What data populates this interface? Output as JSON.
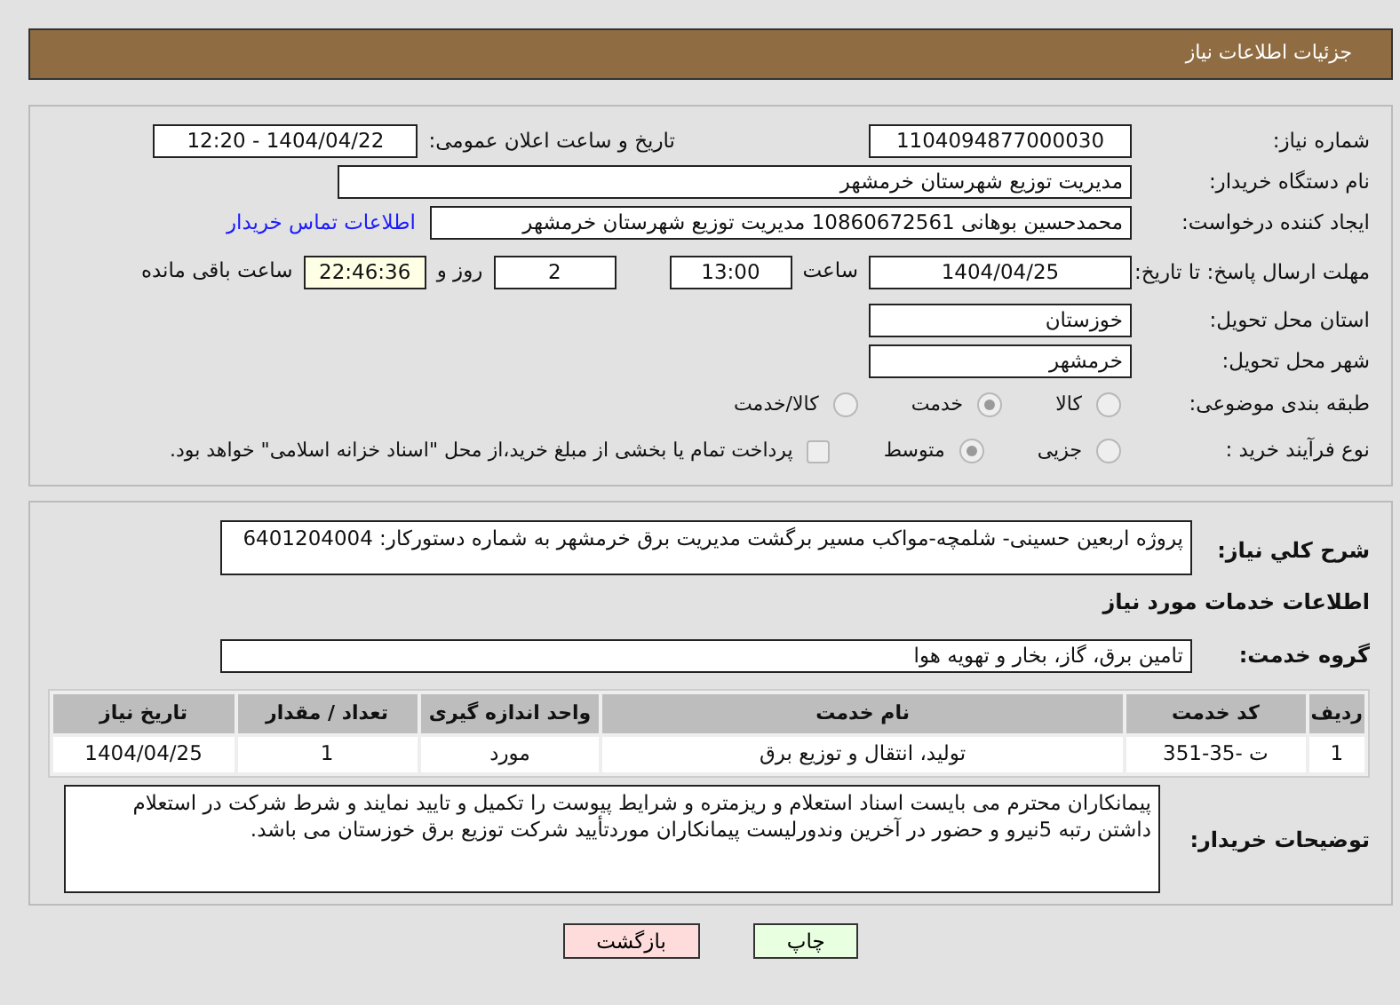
{
  "header": {
    "title": "جزئیات اطلاعات نیاز"
  },
  "need_number": {
    "label": "شماره نیاز:",
    "value": "1104094877000030"
  },
  "announce": {
    "label": "تاریخ و ساعت اعلان عمومی:",
    "value": "1404/04/22 - 12:20"
  },
  "buyer_org": {
    "label": "نام دستگاه خریدار:",
    "value": "مدیریت توزیع شهرستان خرمشهر"
  },
  "requester": {
    "label": "ایجاد کننده درخواست:",
    "value": "محمدحسین بوهانی 10860672561 مدیریت توزیع شهرستان خرمشهر",
    "link": "اطلاعات تماس خریدار"
  },
  "deadline": {
    "label": "مهلت ارسال پاسخ: تا تاریخ:",
    "date": "1404/04/25",
    "time_label": "ساعت",
    "time": "13:00",
    "days": "2",
    "days_label": "روز و",
    "remaining": "22:46:36",
    "remaining_label": "ساعت باقی مانده"
  },
  "province": {
    "label": "استان محل تحویل:",
    "value": "خوزستان"
  },
  "city": {
    "label": "شهر محل تحویل:",
    "value": "خرمشهر"
  },
  "category": {
    "label": "طبقه بندی موضوعی:",
    "options": [
      {
        "label": "کالا",
        "selected": false
      },
      {
        "label": "خدمت",
        "selected": true
      },
      {
        "label": "کالا/خدمت",
        "selected": false
      }
    ]
  },
  "process": {
    "label": "نوع فرآیند خرید :",
    "options": [
      {
        "label": "جزیی",
        "selected": false
      },
      {
        "label": "متوسط",
        "selected": true
      }
    ],
    "payment": {
      "label": "پرداخت تمام یا بخشی از مبلغ خرید،از محل \"اسناد خزانه اسلامی\" خواهد بود.",
      "checked": false
    }
  },
  "description": {
    "label": "شرح کلي نیاز:",
    "value": "پروژه اربعین حسینی- شلمچه-مواکب مسیر برگشت مدیریت برق خرمشهر به شماره دستورکار: 6401204004"
  },
  "services_title": "اطلاعات خدمات مورد نیاز",
  "service_group": {
    "label": "گروه خدمت:",
    "value": "تامین برق، گاز، بخار و تهویه هوا"
  },
  "table": {
    "columns": [
      "ردیف",
      "کد خدمت",
      "نام خدمت",
      "واحد اندازه گیری",
      "تعداد / مقدار",
      "تاریخ نیاز"
    ],
    "rows": [
      [
        "1",
        "ت -35-351",
        "تولید، انتقال و توزیع برق",
        "مورد",
        "1",
        "1404/04/25"
      ]
    ]
  },
  "buyer_notes": {
    "label": "توضیحات خریدار:",
    "value": "پیمانکاران محترم می بایست اسناد استعلام و ریزمتره و شرایط پیوست را تکمیل و تایید نمایند و شرط شرکت در استعلام داشتن رتبه 5نیرو و حضور در آخرین وندورلیست پیمانکاران موردتأیید شرکت توزیع برق خوزستان می باشد."
  },
  "buttons": [
    {
      "label": "چاپ",
      "kind": "print"
    },
    {
      "label": "بازگشت",
      "kind": "back"
    }
  ]
}
